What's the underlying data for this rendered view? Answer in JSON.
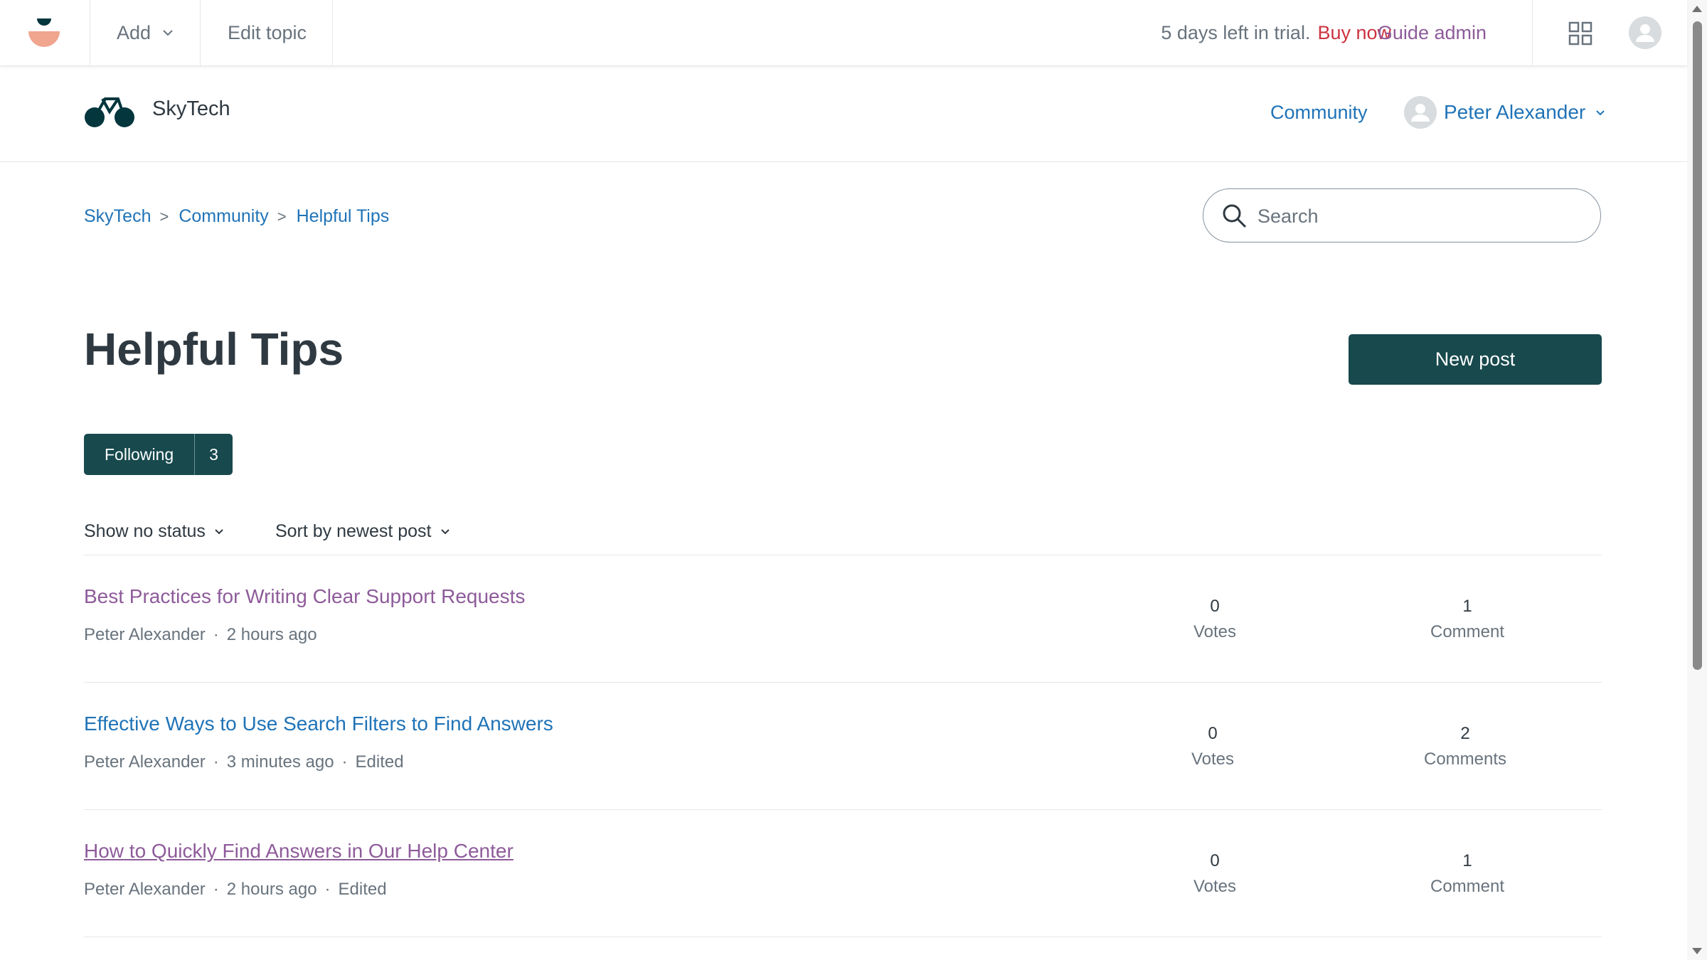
{
  "admin_bar": {
    "add_label": "Add",
    "edit_topic_label": "Edit topic",
    "trial_text": "5 days left in trial.",
    "buy_now": "Buy now",
    "guide_admin": "Guide admin",
    "logo_icon": "zendesk-logo-icon",
    "apps_icon": "grid-icon",
    "user_icon": "user-avatar-icon"
  },
  "header": {
    "brand": "SkyTech",
    "brand_icon": "bicycle-logo-icon",
    "nav_community": "Community",
    "user_name": "Peter Alexander"
  },
  "breadcrumb": [
    "SkyTech",
    "Community",
    "Helpful Tips"
  ],
  "search": {
    "placeholder": "Search"
  },
  "page": {
    "title": "Helpful Tips",
    "new_post": "New post",
    "following_label": "Following",
    "following_count": "3"
  },
  "filters": {
    "status": "Show no status",
    "sort": "Sort by newest post"
  },
  "posts": [
    {
      "title": "Best Practices for Writing Clear Support Requests",
      "author": "Peter Alexander",
      "time": "2 hours ago",
      "edited": "",
      "votes": "0",
      "votes_label": "Votes",
      "comments": "1",
      "comments_label": "Comment"
    },
    {
      "title": "Effective Ways to Use Search Filters to Find Answers",
      "author": "Peter Alexander",
      "time": "3 minutes ago",
      "edited": "Edited",
      "votes": "0",
      "votes_label": "Votes",
      "comments": "2",
      "comments_label": "Comments"
    },
    {
      "title": "How to Quickly Find Answers in Our Help Center",
      "author": "Peter Alexander",
      "time": "2 hours ago",
      "edited": "Edited",
      "votes": "0",
      "votes_label": "Votes",
      "comments": "1",
      "comments_label": "Comment"
    }
  ],
  "colors": {
    "brand_dark": "#17494d",
    "link": "#1f73b7",
    "visited": "#8e5b9a",
    "buy_now": "#cc3340"
  }
}
